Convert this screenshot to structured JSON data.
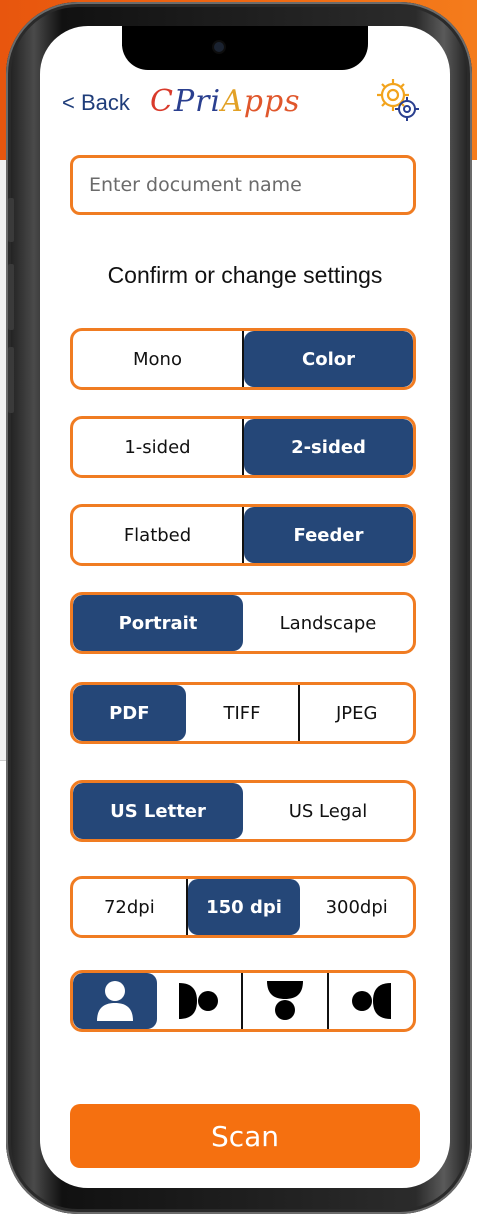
{
  "header": {
    "back_label": "< Back",
    "logo": {
      "text_parts": [
        "C",
        "Pri",
        "A",
        "pps"
      ]
    },
    "settings_icon": "gear-icon"
  },
  "document": {
    "placeholder": "Enter document name",
    "value": ""
  },
  "subtitle": "Confirm or change settings",
  "settings": {
    "color_mode": {
      "options": [
        "Mono",
        "Color"
      ],
      "selected": "Color"
    },
    "sides": {
      "options": [
        "1-sided",
        "2-sided"
      ],
      "selected": "2-sided"
    },
    "source": {
      "options": [
        "Flatbed",
        "Feeder"
      ],
      "selected": "Feeder"
    },
    "orientation": {
      "options": [
        "Portrait",
        "Landscape"
      ],
      "selected": "Portrait"
    },
    "format": {
      "options": [
        "PDF",
        "TIFF",
        "JPEG"
      ],
      "selected": "PDF"
    },
    "paper": {
      "options": [
        "US Letter",
        "US Legal"
      ],
      "selected": "US Letter"
    },
    "resolution": {
      "options": [
        "72dpi",
        "150 dpi",
        "300dpi"
      ],
      "selected": "150 dpi"
    },
    "rotation_icons": {
      "icons": [
        "person-upright-icon",
        "person-rotated-right-icon",
        "person-upside-down-icon",
        "person-rotated-left-icon"
      ],
      "selected": "person-upright-icon"
    }
  },
  "scan_label": "Scan",
  "colors": {
    "accent": "#f07c22",
    "selected": "#254778",
    "scan_button": "#f57010",
    "back_link": "#1f3d7a"
  }
}
